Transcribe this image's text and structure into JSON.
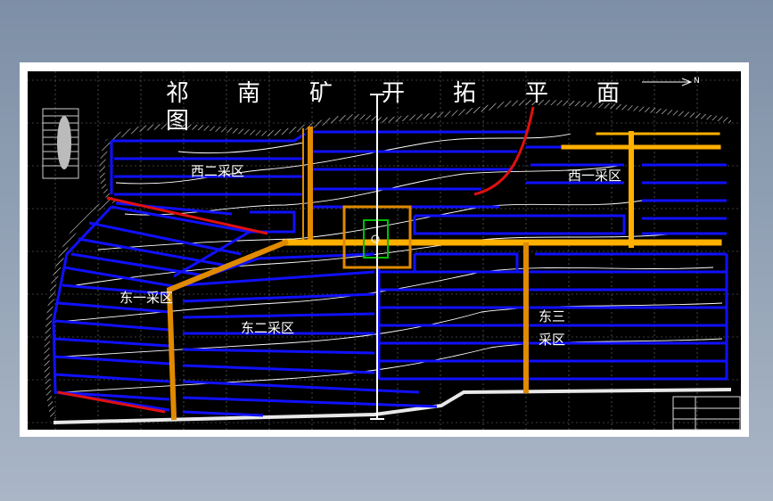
{
  "title_chars": [
    "祁",
    "南",
    "矿",
    "开",
    "拓",
    "平",
    "面",
    "图"
  ],
  "north_mark": "N",
  "zones": {
    "west_2": "西二采区",
    "west_1": "西一采区",
    "east_1": "东一采区",
    "east_2": "东二采区",
    "east_3_a": "东三",
    "east_3_b": "采区"
  },
  "title_block": {
    "label": "祁南矿开拓平面图"
  },
  "colors": {
    "panel": "#1010ff",
    "roadway": "#e08a00",
    "main_roadway": "#ffb000",
    "fault": "#e01010",
    "contour": "#ffffff",
    "shaft_box": "#00c000"
  }
}
